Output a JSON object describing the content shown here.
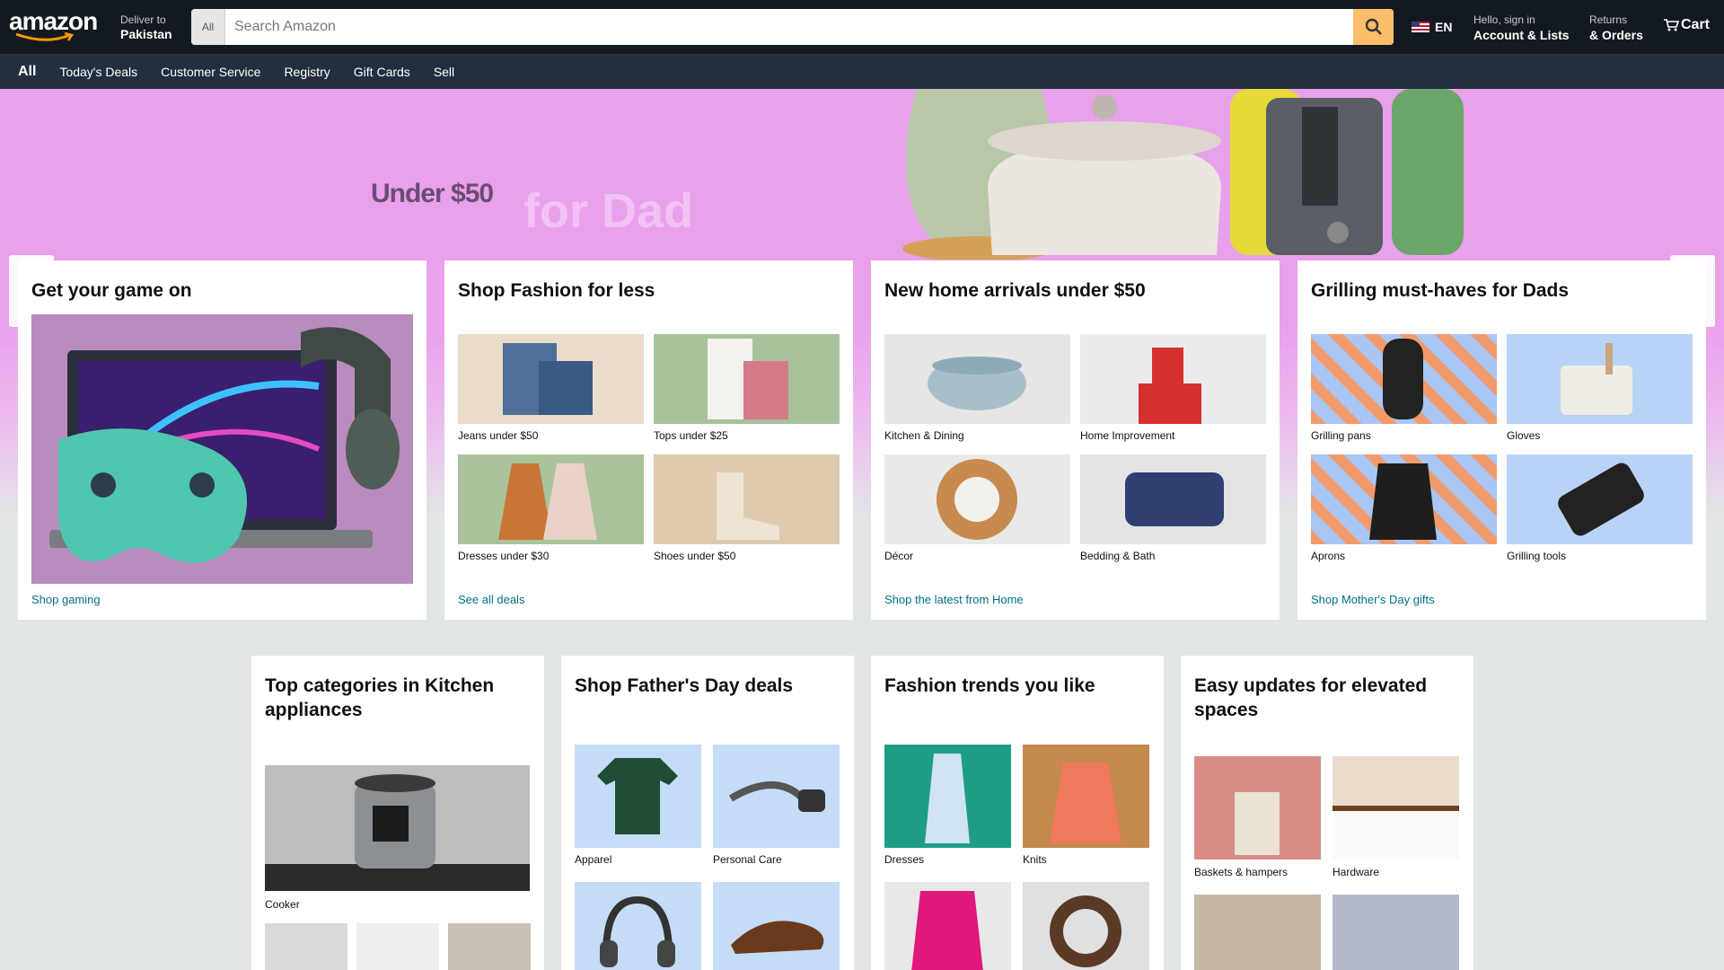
{
  "header": {
    "logo": "amazon",
    "deliver_line1": "Deliver to",
    "deliver_line2": "Pakistan",
    "search_category": "All",
    "search_placeholder": "Search Amazon",
    "language": "EN",
    "account_line1": "Hello, sign in",
    "account_line2": "Account & Lists",
    "returns_line1": "Returns",
    "returns_line2": "& Orders",
    "cart_label": "Cart"
  },
  "nav": {
    "all": "All",
    "items": [
      "Today's Deals",
      "Customer Service",
      "Registry",
      "Gift Cards",
      "Sell"
    ]
  },
  "hero": {
    "text1": "Under $50",
    "text2": "for Dad",
    "prev": "❮",
    "next": "❯"
  },
  "cards_row1": [
    {
      "title": "Get your game on",
      "link": "Shop gaming"
    },
    {
      "title": "Shop Fashion for less",
      "tiles": [
        "Jeans under $50",
        "Tops under $25",
        "Dresses under $30",
        "Shoes under $50"
      ],
      "link": "See all deals"
    },
    {
      "title": "New home arrivals under $50",
      "tiles": [
        "Kitchen & Dining",
        "Home Improvement",
        "Décor",
        "Bedding & Bath"
      ],
      "link": "Shop the latest from Home"
    },
    {
      "title": "Grilling must-haves for Dads",
      "tiles": [
        "Grilling pans",
        "Gloves",
        "Aprons",
        "Grilling tools"
      ],
      "link": "Shop Mother's Day gifts"
    }
  ],
  "cards_row2": [
    {
      "title": "Top categories in Kitchen appliances",
      "tiles": [
        "Cooker"
      ]
    },
    {
      "title": "Shop Father's Day deals",
      "tiles": [
        "Apparel",
        "Personal Care"
      ]
    },
    {
      "title": "Fashion trends you like",
      "tiles": [
        "Dresses",
        "Knits"
      ]
    },
    {
      "title": "Easy updates for elevated spaces",
      "tiles": [
        "Baskets & hampers",
        "Hardware"
      ]
    }
  ],
  "colors": {
    "header_bg": "#131921",
    "nav_bg": "#232f3e",
    "search_button": "#febd69",
    "hero_bg": "#e9a1ec",
    "link": "#007185"
  }
}
